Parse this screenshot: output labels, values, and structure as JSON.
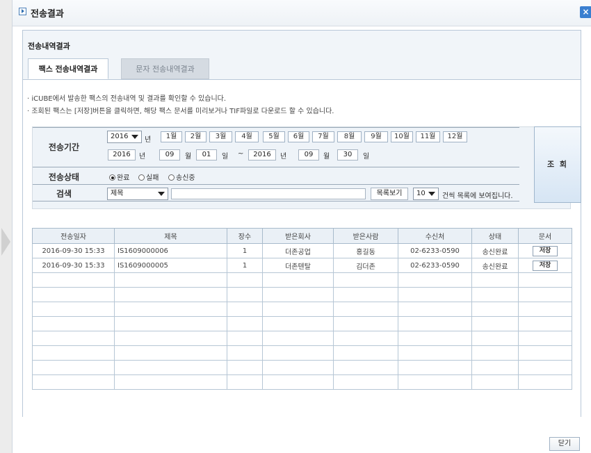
{
  "window": {
    "title": "전송결과",
    "close_glyph": "×"
  },
  "section_title": "전송내역결과",
  "tabs": [
    {
      "label": "팩스 전송내역결과",
      "active": true
    },
    {
      "label": "문자 전송내역결과",
      "active": false
    }
  ],
  "notices": [
    "· iCUBE에서 발송한 팩스의 전송내역 및 결과를 확인할 수 있습니다.",
    "· 조회된 팩스는 [저장]버튼을 클릭하면, 해당 팩스 문서를 미리보거나 TIF파일로 다운로드 할 수 있습니다."
  ],
  "search": {
    "period_label": "전송기간",
    "year_select": "2016",
    "year_unit": "년",
    "months": [
      "1월",
      "2월",
      "3월",
      "4월",
      "5월",
      "6월",
      "7월",
      "8월",
      "9월",
      "10월",
      "11월",
      "12월"
    ],
    "from": {
      "year": "2016",
      "month": "09",
      "day": "01"
    },
    "to": {
      "year": "2016",
      "month": "09",
      "day": "30"
    },
    "unit_year": "년",
    "unit_month": "월",
    "unit_day": "일",
    "tilde": "~",
    "status_label": "전송상태",
    "status_options": [
      {
        "label": "완료",
        "selected": true
      },
      {
        "label": "실패",
        "selected": false
      },
      {
        "label": "송신중",
        "selected": false
      }
    ],
    "keyword_label": "검색",
    "field_select": "제목",
    "keyword_value": "",
    "list_view_label": "목록보기",
    "page_size": "10",
    "page_size_suffix": "건씩 목록에 보여집니다.",
    "query_button": "조 회"
  },
  "table": {
    "columns": [
      "전송일자",
      "제목",
      "장수",
      "받은회사",
      "받은사람",
      "수신처",
      "상태",
      "문서"
    ],
    "rows": [
      {
        "date": "2016-09-30 15:33",
        "title": "IS1609000006",
        "pages": "1",
        "company": "더존공업",
        "person": "홍길동",
        "fax": "02-6233-0590",
        "status": "송신완료",
        "doc": "저장"
      },
      {
        "date": "2016-09-30 15:33",
        "title": "IS1609000005",
        "pages": "1",
        "company": "더존텐탈",
        "person": "김더존",
        "fax": "02-6233-0590",
        "status": "송신완료",
        "doc": "저장"
      }
    ],
    "empty_rows": 8
  },
  "footer": {
    "close_label": "닫기"
  },
  "colors": {
    "accent": "#3a7fd0",
    "panel_bg": "#f1f5f9",
    "header_bg": "#eaf0f6"
  }
}
